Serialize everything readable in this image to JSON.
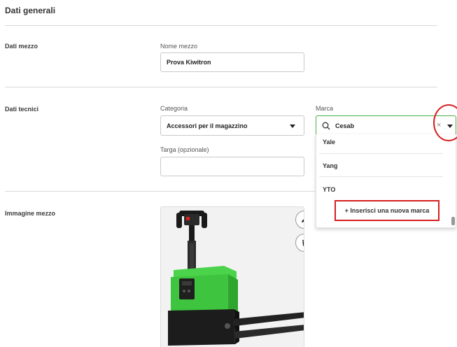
{
  "header": {
    "title": "Dati generali"
  },
  "dati_mezzo": {
    "section_label": "Dati mezzo",
    "nome_label": "Nome mezzo",
    "nome_value": "Prova Kiwitron"
  },
  "dati_tecnici": {
    "section_label": "Dati tecnici",
    "categoria_label": "Categoria",
    "categoria_value": "Accessori per il magazzino",
    "targa_label": "Targa (opzionale)",
    "targa_value": "",
    "marca_label": "Marca",
    "marca_value": "Cesab",
    "marca_options": [
      "Yale",
      "Yang",
      "YTO"
    ],
    "add_brand_label": "+ Inserisci una nuova marca"
  },
  "immagine": {
    "section_label": "Immagine mezzo",
    "edit_icon": "pencil-icon",
    "delete_icon": "trash-icon"
  },
  "colors": {
    "accent_green": "#44b04a",
    "highlight_red": "#d61f1f",
    "truck_green": "#3ec43e"
  }
}
